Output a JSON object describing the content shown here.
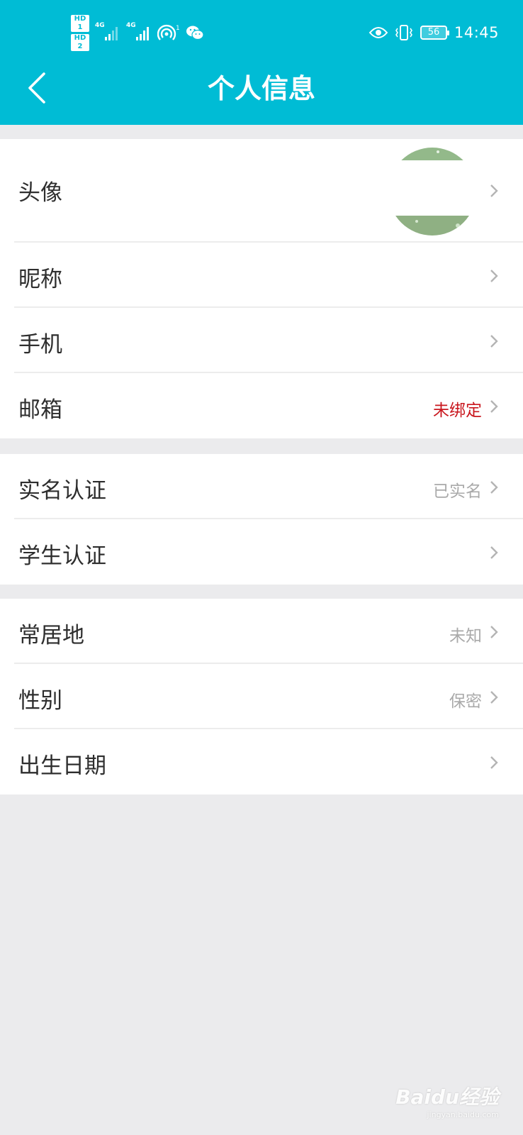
{
  "status_bar": {
    "hd_badges": [
      "HD 1",
      "HD 2"
    ],
    "network_labels": [
      "4G",
      "4G"
    ],
    "hotspot_count": "1",
    "battery": "56",
    "time": "14:45",
    "icons": [
      "hd-icon",
      "signal-icon",
      "hotspot-icon",
      "wechat-icon",
      "eye-icon",
      "vibrate-icon",
      "battery-icon"
    ]
  },
  "header": {
    "title": "个人信息",
    "background": "#00bcd5"
  },
  "rows": [
    {
      "label": "头像",
      "value": ""
    },
    {
      "label": "昵称",
      "value": ""
    },
    {
      "label": "手机",
      "value": ""
    },
    {
      "label": "邮箱",
      "value": "未绑定",
      "value_color": "#c9171e"
    },
    {
      "label": "实名认证",
      "value": "已实名"
    },
    {
      "label": "学生认证",
      "value": ""
    },
    {
      "label": "常居地",
      "value": "未知"
    },
    {
      "label": "性别",
      "value": "保密"
    },
    {
      "label": "出生日期",
      "value": ""
    }
  ],
  "watermark": {
    "text": "Baidu经验",
    "url": "jingyan.baidu.com"
  }
}
